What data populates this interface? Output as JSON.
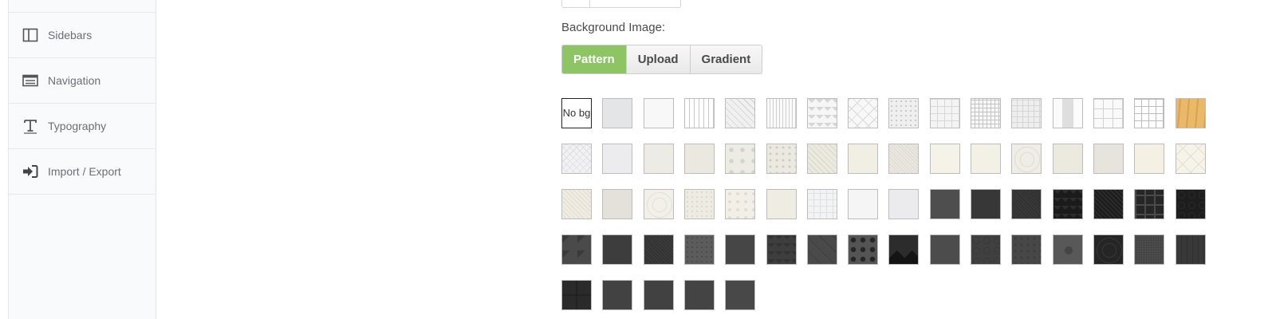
{
  "sidebar": {
    "items": [
      {
        "label": "Sidebars",
        "icon": "columns-icon"
      },
      {
        "label": "Navigation",
        "icon": "list-icon"
      },
      {
        "label": "Typography",
        "icon": "text-height-icon"
      },
      {
        "label": "Import / Export",
        "icon": "sign-in-icon"
      }
    ]
  },
  "background": {
    "label": "Background Image:",
    "tabs": [
      {
        "label": "Pattern",
        "active": true
      },
      {
        "label": "Upload",
        "active": false
      },
      {
        "label": "Gradient",
        "active": false
      }
    ],
    "no_bg_label": "No bg"
  },
  "accent_color": "#8dc564",
  "patterns": [
    {
      "style": "nobg"
    },
    {
      "style": "solid",
      "color": "#e4e5e7"
    },
    {
      "style": "solid",
      "color": "#f8f8f8"
    },
    {
      "style": "vstripe",
      "color": "#ffffff",
      "line": "#c8c8c8",
      "gap": 6
    },
    {
      "style": "diag",
      "color": "#f0f0f0",
      "line": "#cfcfcf",
      "gap": 6
    },
    {
      "style": "vstripe",
      "color": "#fafafa",
      "line": "#d0d0d0",
      "gap": 4
    },
    {
      "style": "zigzag",
      "color": "#f6f6f6",
      "line": "#d6d6d6"
    },
    {
      "style": "cross",
      "color": "#f8f8f8",
      "line": "#d8d8d8",
      "gap": 10
    },
    {
      "style": "dots",
      "color": "#efefef",
      "line": "#c9c9c9",
      "gap": 3
    },
    {
      "style": "grid",
      "color": "#f4f4f4",
      "line": "#d8d8d8",
      "gap": 9
    },
    {
      "style": "grid",
      "color": "#f7f7f7",
      "line": "#c4c4c4",
      "gap": 5
    },
    {
      "style": "grid",
      "color": "#eeeeee",
      "line": "#d5d5d5",
      "gap": 7
    },
    {
      "style": "panel",
      "color": "#fbfbfb",
      "line": "#dedede"
    },
    {
      "style": "grid",
      "color": "#fafafa",
      "line": "#d2d2d2",
      "gap": 12
    },
    {
      "style": "grid",
      "color": "#ffffff",
      "line": "#bcbcbc",
      "gap": 9
    },
    {
      "style": "wood",
      "color": "#e9b868",
      "line": "#d9a250"
    },
    {
      "style": "cross",
      "color": "#f2f2f5",
      "line": "#dcdce2",
      "gap": 6
    },
    {
      "style": "solid",
      "color": "#ececee"
    },
    {
      "style": "solid",
      "color": "#ecebe5"
    },
    {
      "style": "solid",
      "color": "#ebe9df"
    },
    {
      "style": "dots",
      "color": "#ecebe4",
      "line": "#d6d4ca",
      "gap": 7
    },
    {
      "style": "dots",
      "color": "#ebe9e0",
      "line": "#cfcdc2",
      "gap": 4
    },
    {
      "style": "diag",
      "color": "#eceadf",
      "line": "#d8d6ca",
      "gap": 5
    },
    {
      "style": "solid",
      "color": "#f1efe4"
    },
    {
      "style": "diag",
      "color": "#eae8e0",
      "line": "#dcdad0",
      "gap": 3
    },
    {
      "style": "solid",
      "color": "#f5f2e7"
    },
    {
      "style": "solid",
      "color": "#f3f0e6"
    },
    {
      "style": "circles",
      "color": "#efede5",
      "line": "#d8d6cc"
    },
    {
      "style": "solid",
      "color": "#ece9df"
    },
    {
      "style": "solid",
      "color": "#e6e4dc"
    },
    {
      "style": "solid",
      "color": "#f4f1e4"
    },
    {
      "style": "cross",
      "color": "#f6f3e9",
      "line": "#e3dfd2",
      "gap": 14
    },
    {
      "style": "diag",
      "color": "#f0ece2",
      "line": "#e0dbcf",
      "gap": 4
    },
    {
      "style": "solid",
      "color": "#e3e1da"
    },
    {
      "style": "circles",
      "color": "#f2f0e8",
      "line": "#dedbd1"
    },
    {
      "style": "dots",
      "color": "#eeebe3",
      "line": "#dcd9cf",
      "gap": 3
    },
    {
      "style": "dots",
      "color": "#f2efe6",
      "line": "#e0dcd2",
      "gap": 5
    },
    {
      "style": "solid",
      "color": "#efece1"
    },
    {
      "style": "grid",
      "color": "#f2f3f4",
      "line": "#dfe0e2",
      "gap": 8
    },
    {
      "style": "solid",
      "color": "#f5f5f6"
    },
    {
      "style": "solid",
      "color": "#ebebed"
    },
    {
      "style": "solid",
      "color": "#4e4e4e"
    },
    {
      "style": "solid",
      "color": "#373737"
    },
    {
      "style": "diag",
      "color": "#383838",
      "line": "#2e2e2e",
      "gap": 3
    },
    {
      "style": "zigzag",
      "color": "#1b1b1b",
      "line": "#2d2d2d"
    },
    {
      "style": "diag",
      "color": "#1e1e1e",
      "line": "#333333",
      "gap": 4
    },
    {
      "style": "maze",
      "color": "#262626",
      "line": "#4a4a4a"
    },
    {
      "style": "hex",
      "color": "#1d1d1d",
      "line": "#3d3d3d"
    },
    {
      "style": "cube",
      "color": "#4a4a4a",
      "line": "#3a3a3a"
    },
    {
      "style": "solid",
      "color": "#3d3d3d"
    },
    {
      "style": "diag",
      "color": "#333333",
      "line": "#3f3f3f",
      "gap": 3
    },
    {
      "style": "dots",
      "color": "#5c5c5c",
      "line": "#4d4d4d",
      "gap": 3
    },
    {
      "style": "solid",
      "color": "#464646"
    },
    {
      "style": "zigzag",
      "color": "#3e3e3e",
      "line": "#333333"
    },
    {
      "style": "diag",
      "color": "#4a4a4a",
      "line": "#3c3c3c",
      "gap": 12
    },
    {
      "style": "bigdots",
      "color": "#545454",
      "line": "#262626"
    },
    {
      "style": "triangle",
      "color": "#141414",
      "line": "#2c2c2c"
    },
    {
      "style": "solid",
      "color": "#4c4c4c"
    },
    {
      "style": "hex",
      "color": "#404040",
      "line": "#2c2c2c"
    },
    {
      "style": "dots",
      "color": "#474747",
      "line": "#3c3c3c",
      "gap": 4
    },
    {
      "style": "star",
      "color": "#585858",
      "line": "#454545"
    },
    {
      "style": "circles",
      "color": "#252525",
      "line": "#3b3b3b"
    },
    {
      "style": "grid",
      "color": "#4e4e4e",
      "line": "#444444",
      "gap": 3
    },
    {
      "style": "vstripe",
      "color": "#383838",
      "line": "#2f2f2f",
      "gap": 7
    },
    {
      "style": "quad",
      "color": "#2a2a2a",
      "line": "#1a1a1a"
    },
    {
      "style": "solid",
      "color": "#424242"
    },
    {
      "style": "solid",
      "color": "#414141"
    },
    {
      "style": "solid",
      "color": "#444444"
    },
    {
      "style": "solid",
      "color": "#484848"
    }
  ]
}
